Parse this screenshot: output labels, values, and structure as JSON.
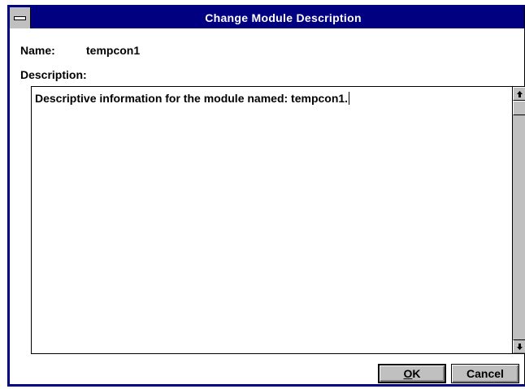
{
  "window": {
    "title": "Change Module Description"
  },
  "form": {
    "name_label": "Name:",
    "name_value": "tempcon1",
    "description_label": "Description:",
    "description_value": "Descriptive information for the module named: tempcon1."
  },
  "buttons": {
    "ok_mnemonic": "O",
    "ok_rest": "K",
    "cancel_label": "Cancel"
  },
  "icons": {
    "system_menu": "system-menu-icon",
    "scroll_up": "up-arrow-icon",
    "scroll_down": "down-arrow-icon"
  }
}
